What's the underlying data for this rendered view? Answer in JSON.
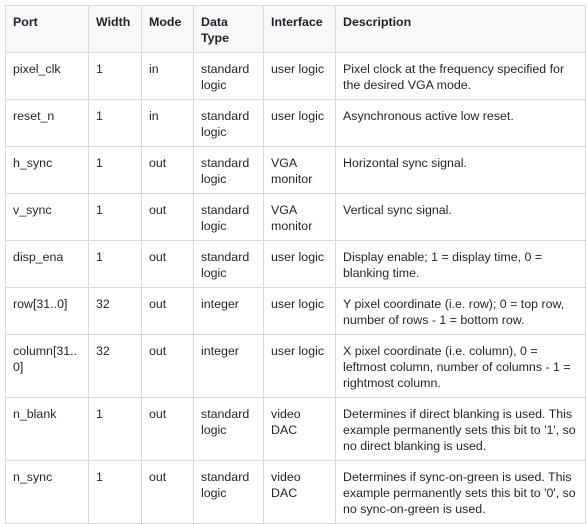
{
  "table": {
    "headers": {
      "port": "Port",
      "width": "Width",
      "mode": "Mode",
      "data_type": "Data Type",
      "interface": "Interface",
      "description": "Description"
    },
    "rows": [
      {
        "port": "pixel_clk",
        "width": "1",
        "mode": "in",
        "data_type": "standard logic",
        "interface": "user logic",
        "description": "Pixel clock at the frequency specified for the desired VGA mode."
      },
      {
        "port": "reset_n",
        "width": "1",
        "mode": "in",
        "data_type": "standard logic",
        "interface": "user logic",
        "description": "Asynchronous active low reset."
      },
      {
        "port": "h_sync",
        "width": "1",
        "mode": "out",
        "data_type": "standard logic",
        "interface": "VGA monitor",
        "description": "Horizontal sync signal."
      },
      {
        "port": "v_sync",
        "width": "1",
        "mode": "out",
        "data_type": "standard logic",
        "interface": "VGA monitor",
        "description": "Vertical sync signal."
      },
      {
        "port": "disp_ena",
        "width": "1",
        "mode": "out",
        "data_type": "standard logic",
        "interface": "user logic",
        "description": "Display enable; 1 = display time, 0 = blanking time."
      },
      {
        "port": "row[31..0]",
        "width": "32",
        "mode": "out",
        "data_type": "integer",
        "interface": "user logic",
        "description": "Y pixel coordinate (i.e. row); 0 = top row, number of rows - 1 = bottom row."
      },
      {
        "port": "column[31..0]",
        "width": "32",
        "mode": "out",
        "data_type": "integer",
        "interface": "user logic",
        "description": "X pixel coordinate (i.e. column), 0 = leftmost column, number of columns - 1 = rightmost column."
      },
      {
        "port": "n_blank",
        "width": "1",
        "mode": "out",
        "data_type": "standard logic",
        "interface": "video DAC",
        "description": "Determines if direct blanking is used.  This example permanently sets this bit to '1', so no direct blanking is used."
      },
      {
        "port": "n_sync",
        "width": "1",
        "mode": "out",
        "data_type": "standard logic",
        "interface": "video DAC",
        "description": "Determines if sync-on-green is used.  This example permanently sets this bit to '0', so no sync-on-green is used."
      }
    ]
  }
}
